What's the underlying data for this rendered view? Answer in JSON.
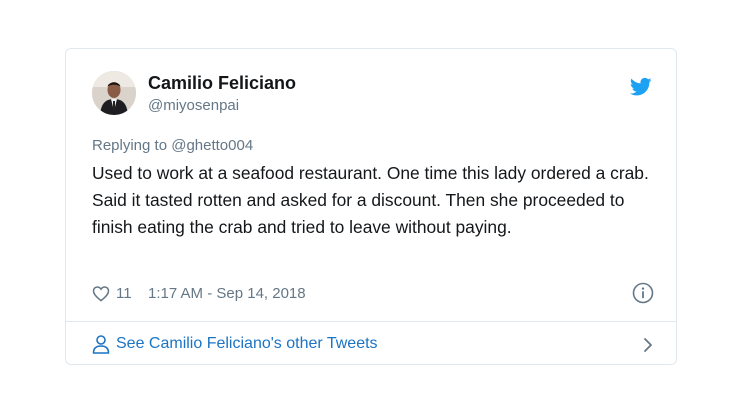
{
  "tweet": {
    "author_name": "Camilio Feliciano",
    "author_handle": "@miyosenpai",
    "replying_to": "Replying to @ghetto004",
    "text": "Used to work at a seafood restaurant. One time this lady ordered a crab. Said it tasted rotten and asked for a discount. Then she proceeded to finish eating the crab and tried to leave without paying.",
    "like_count": "11",
    "timestamp": "1:17 AM - Sep 14, 2018"
  },
  "footer": {
    "link_label": "See Camilio Feliciano's other Tweets"
  },
  "icons": {
    "brand": "twitter-bird-icon",
    "like": "heart-icon",
    "info": "info-icon",
    "profile": "person-icon",
    "more": "chevron-right-icon"
  },
  "colors": {
    "twitter_blue": "#1da1f2",
    "link_blue": "#1b74c4",
    "secondary_text": "#657786",
    "border": "#e1e8ed"
  }
}
